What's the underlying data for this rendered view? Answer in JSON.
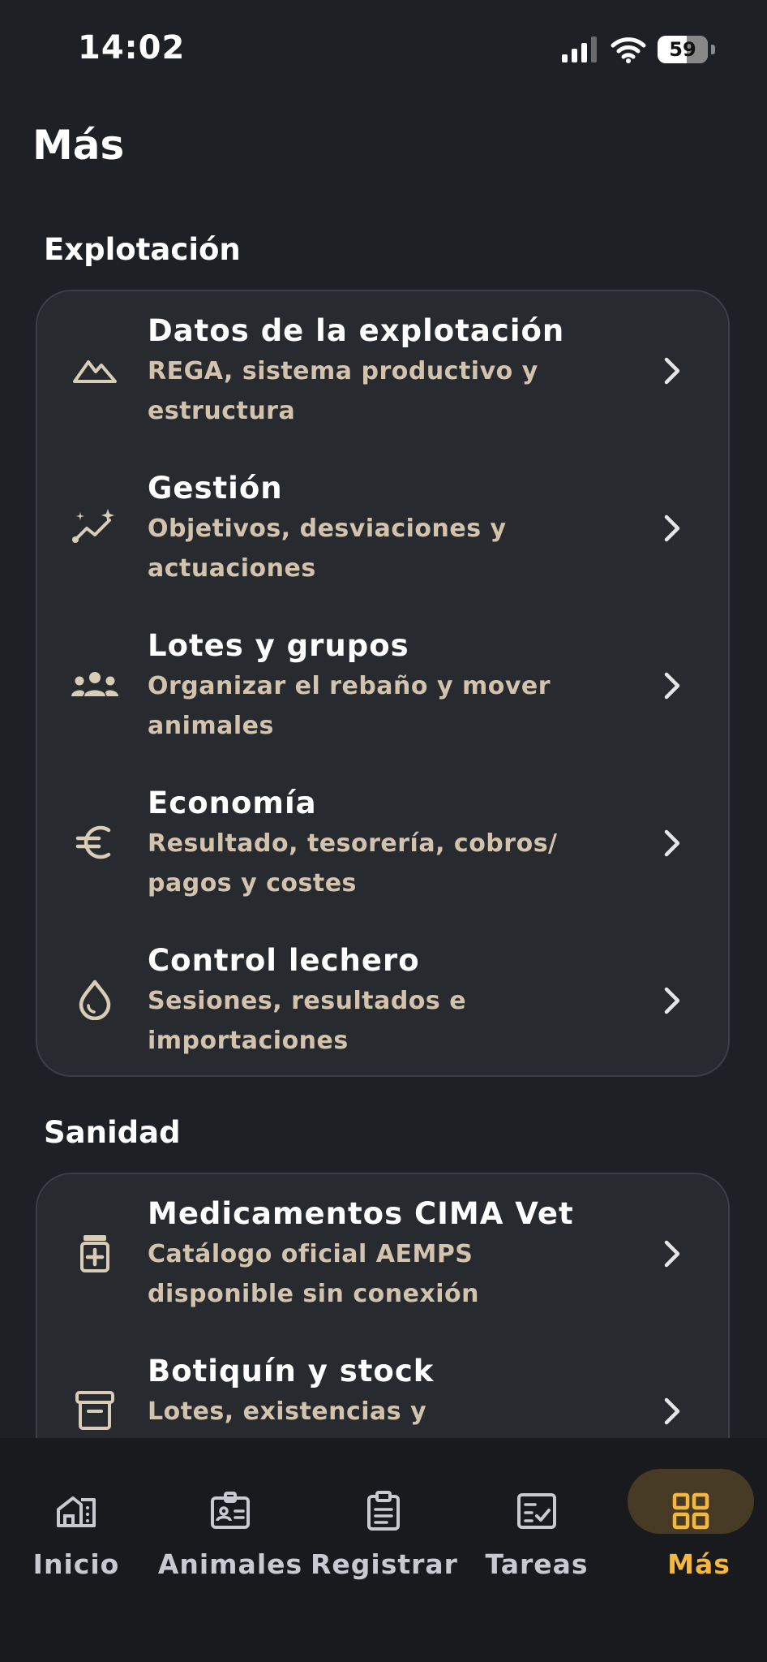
{
  "status_bar": {
    "time": "14:02",
    "battery": "59"
  },
  "page": {
    "title": "Más"
  },
  "sections": [
    {
      "title": "Explotación",
      "items": [
        {
          "title": "Datos de la explotación",
          "subtitle_line1": "REGA, sistema productivo y",
          "subtitle_line2": "estructura",
          "icon": "mountain-icon"
        },
        {
          "title": "Gestión",
          "subtitle_line1": "Objetivos, desviaciones y",
          "subtitle_line2": "actuaciones",
          "icon": "sparkle-trend-icon"
        },
        {
          "title": "Lotes y grupos",
          "subtitle_line1": "Organizar el rebaño y mover",
          "subtitle_line2": "animales",
          "icon": "group-icon"
        },
        {
          "title": "Economía",
          "subtitle_line1": "Resultado, tesorería, cobros/",
          "subtitle_line2": "pagos y costes",
          "icon": "euro-icon"
        },
        {
          "title": "Control lechero",
          "subtitle_line1": "Sesiones, resultados e",
          "subtitle_line2": "importaciones",
          "icon": "drop-icon"
        }
      ]
    },
    {
      "title": "Sanidad",
      "items": [
        {
          "title": "Medicamentos CIMA Vet",
          "subtitle_line1": "Catálogo oficial AEMPS",
          "subtitle_line2": "disponible sin conexión",
          "icon": "medicine-bottle-icon"
        },
        {
          "title": "Botiquín y stock",
          "subtitle_line1": "Lotes, existencias y",
          "subtitle_line2": "",
          "icon": "archive-box-icon"
        }
      ]
    }
  ],
  "bottom_nav": [
    {
      "label": "Inicio",
      "icon": "home-icon"
    },
    {
      "label": "Animales",
      "icon": "id-badge-icon"
    },
    {
      "label": "Registrar",
      "icon": "clipboard-icon"
    },
    {
      "label": "Tareas",
      "icon": "task-check-icon"
    },
    {
      "label": "Más",
      "icon": "grid-icon",
      "active": true
    }
  ],
  "colors": {
    "accent": "#f4b840",
    "subtitle": "#d3c3ad",
    "background": "#1d2024",
    "card": "#272b30"
  }
}
